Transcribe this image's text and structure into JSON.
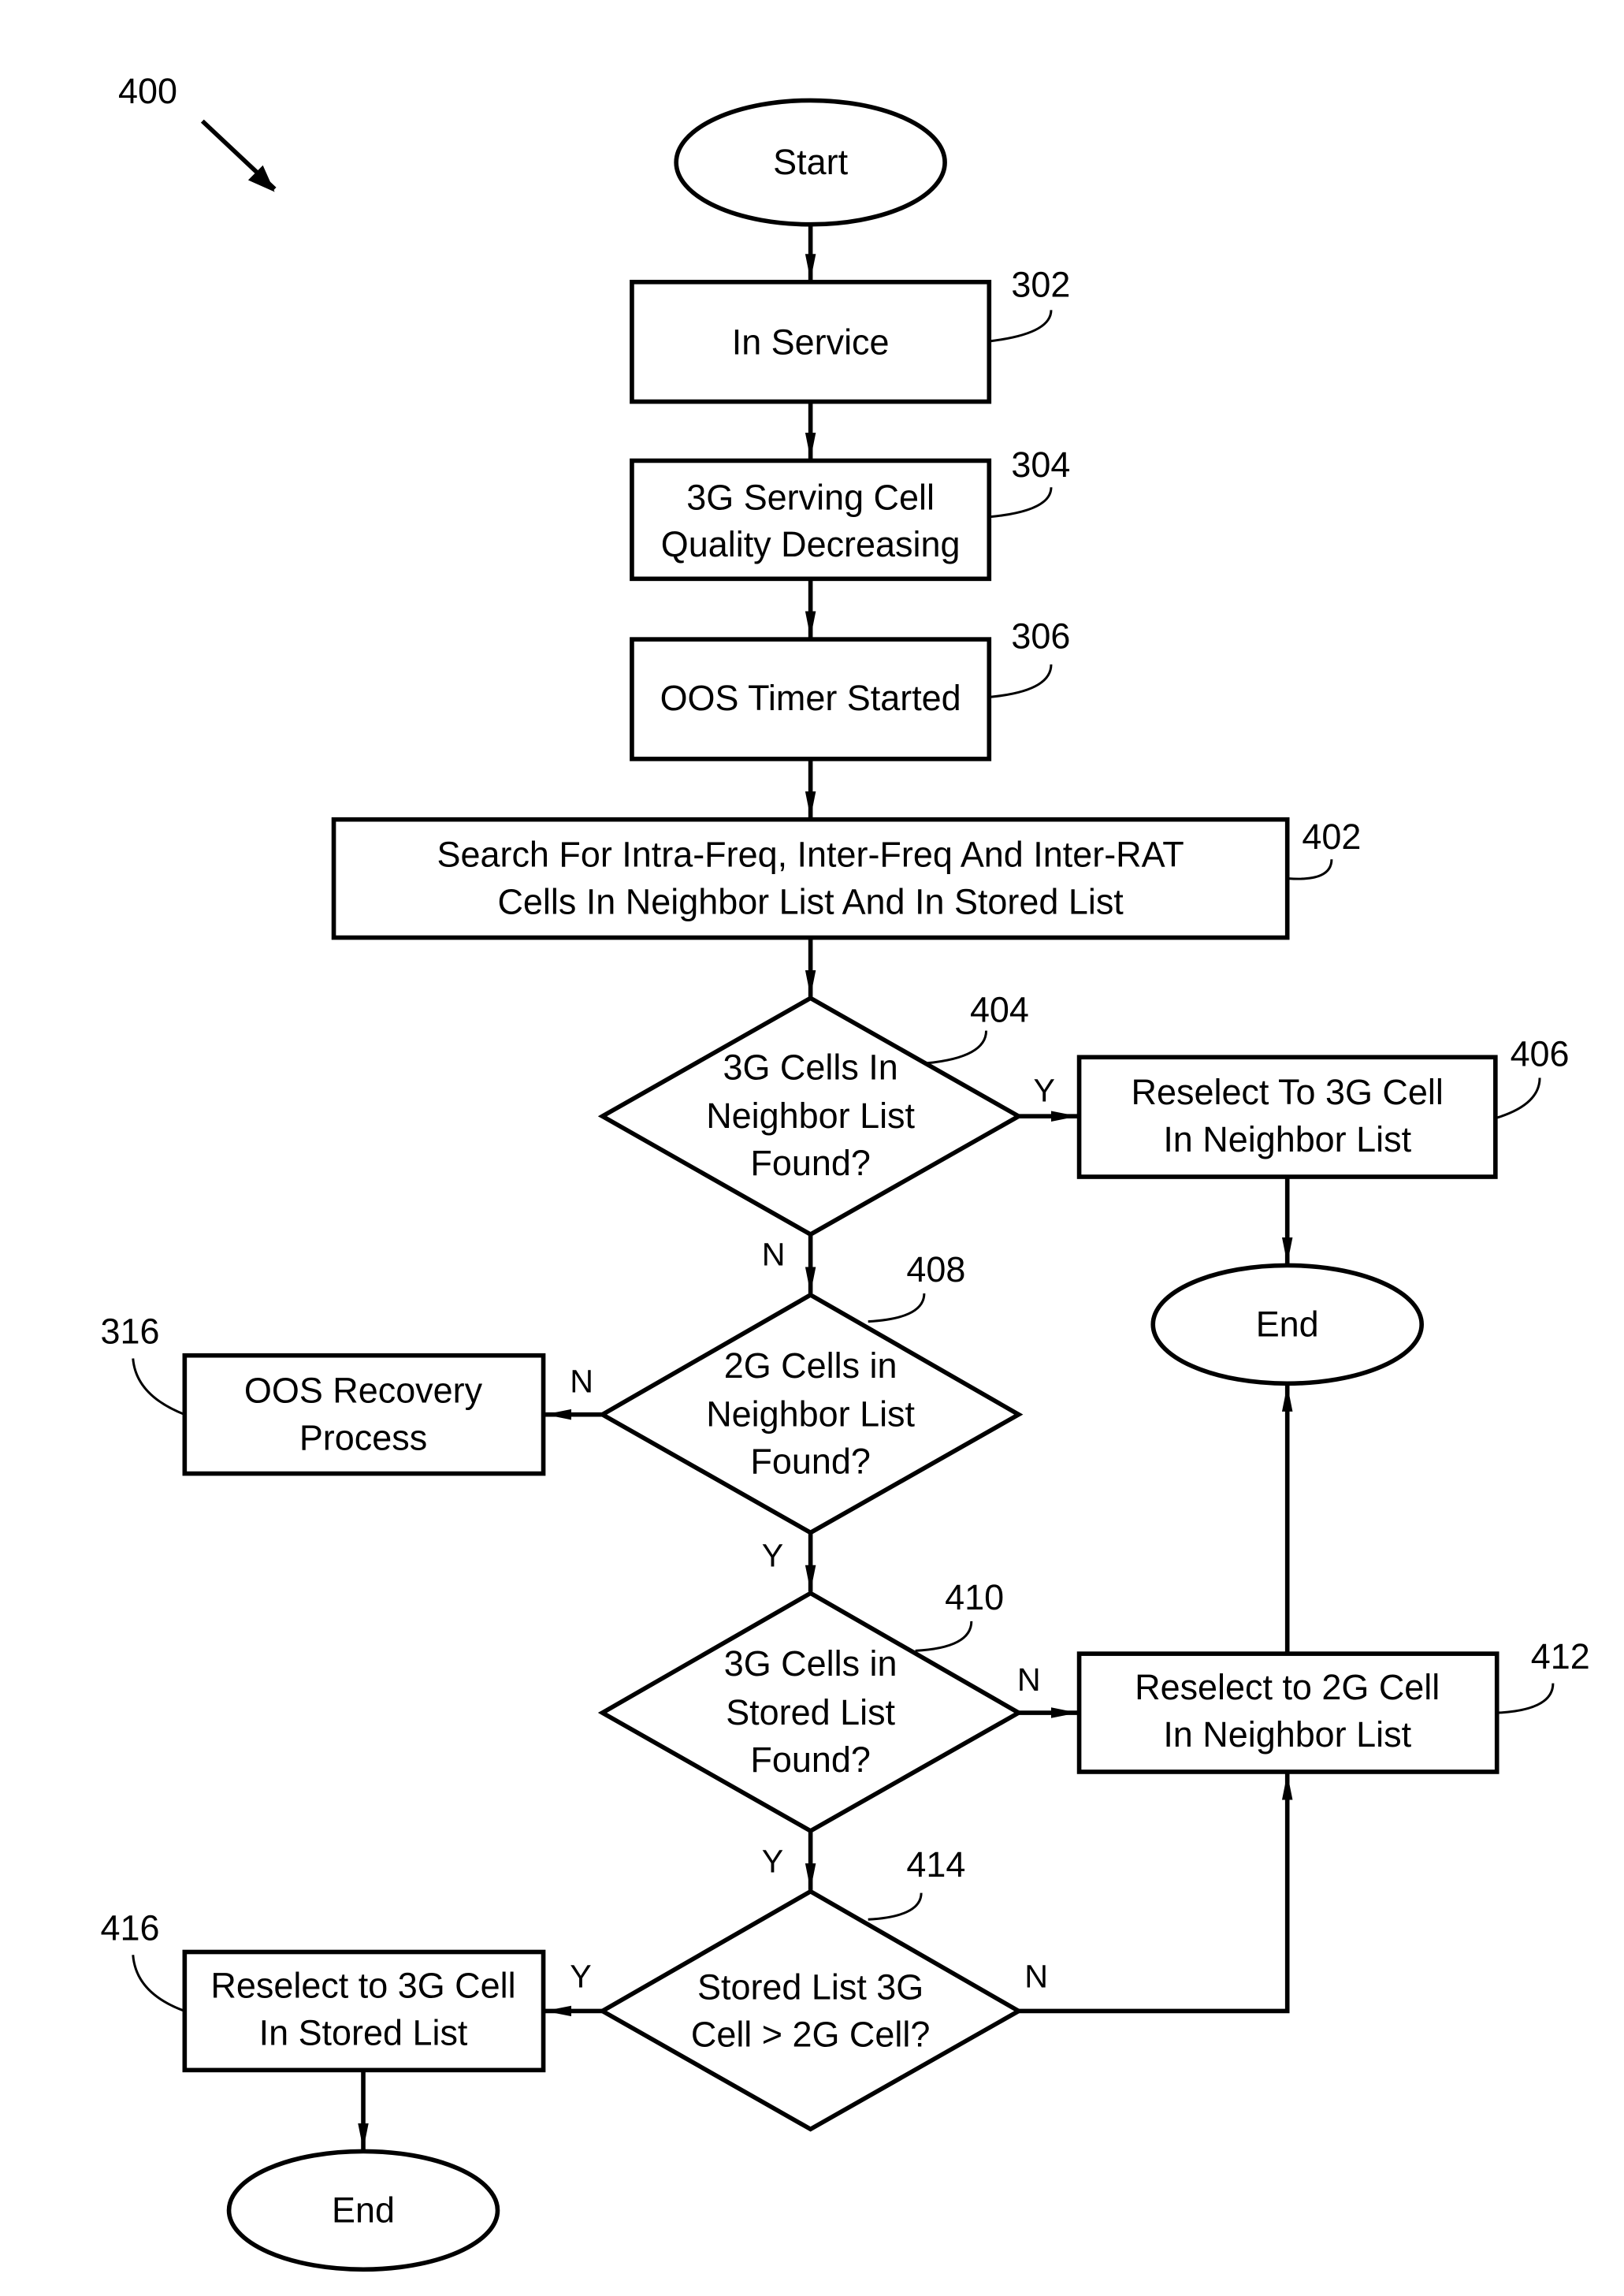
{
  "figure": {
    "ref": "400",
    "colors": {
      "ink": "#000000",
      "background": "#ffffff"
    },
    "nodes": {
      "start": {
        "ref": "",
        "lines": [
          "Start"
        ]
      },
      "n302": {
        "ref": "302",
        "lines": [
          "In Service"
        ]
      },
      "n304": {
        "ref": "304",
        "lines": [
          "3G Serving Cell",
          "Quality Decreasing"
        ]
      },
      "n306": {
        "ref": "306",
        "lines": [
          "OOS Timer Started"
        ]
      },
      "n402": {
        "ref": "402",
        "lines": [
          "Search For Intra-Freq, Inter-Freq And Inter-RAT",
          "Cells In Neighbor List And In Stored List"
        ]
      },
      "n404": {
        "ref": "404",
        "lines": [
          "3G Cells In",
          "Neighbor List",
          "Found?"
        ]
      },
      "n406": {
        "ref": "406",
        "lines": [
          "Reselect To 3G Cell",
          "In Neighbor List"
        ]
      },
      "end1": {
        "ref": "",
        "lines": [
          "End"
        ]
      },
      "n408": {
        "ref": "408",
        "lines": [
          "2G Cells in",
          "Neighbor List",
          "Found?"
        ]
      },
      "n316": {
        "ref": "316",
        "lines": [
          "OOS Recovery",
          "Process"
        ]
      },
      "n410": {
        "ref": "410",
        "lines": [
          "3G Cells in",
          "Stored List",
          "Found?"
        ]
      },
      "n412": {
        "ref": "412",
        "lines": [
          "Reselect to 2G Cell",
          "In Neighbor List"
        ]
      },
      "n414": {
        "ref": "414",
        "lines": [
          "Stored List 3G",
          "Cell > 2G Cell?"
        ]
      },
      "n416": {
        "ref": "416",
        "lines": [
          "Reselect to 3G Cell",
          "In Stored List"
        ]
      },
      "end2": {
        "ref": "",
        "lines": [
          "End"
        ]
      }
    },
    "edge_labels": {
      "e404_yes": "Y",
      "e404_no": "N",
      "e408_no": "N",
      "e408_yes": "Y",
      "e410_no": "N",
      "e410_yes": "Y",
      "e414_yes": "Y",
      "e414_no": "N"
    }
  }
}
